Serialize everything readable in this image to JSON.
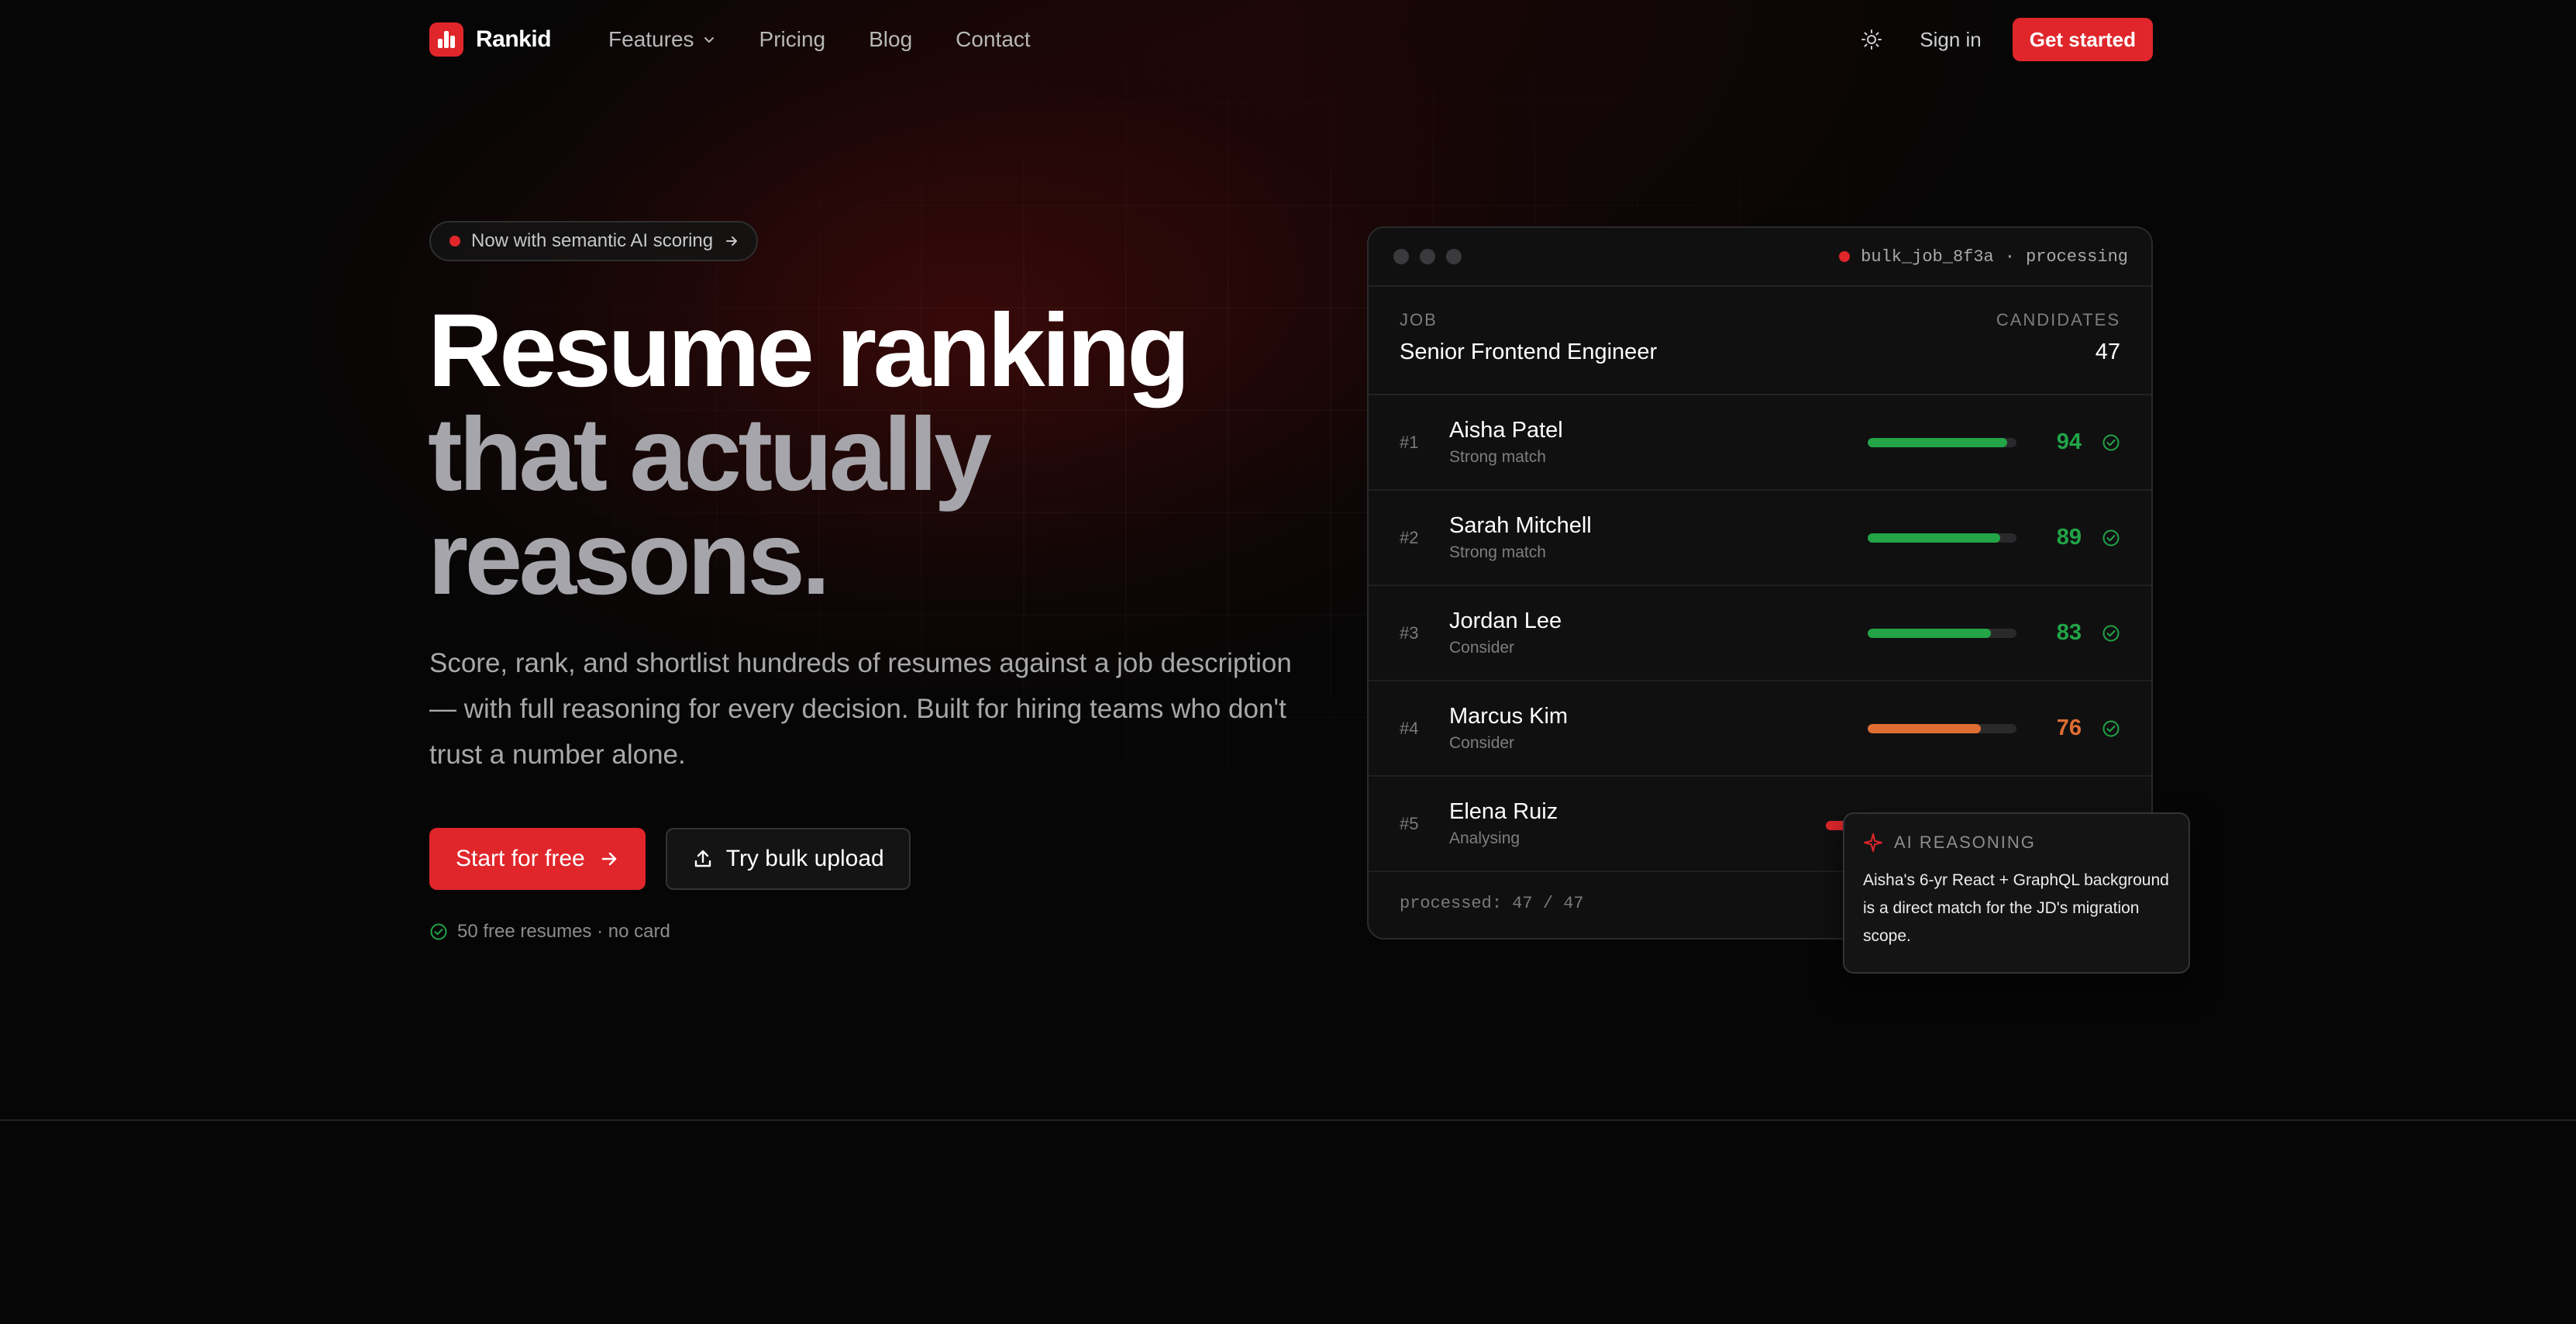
{
  "brand": {
    "name": "Rankid",
    "accent": "#e0262b"
  },
  "nav": {
    "links": [
      {
        "label": "Features",
        "has_dropdown": true
      },
      {
        "label": "Pricing"
      },
      {
        "label": "Blog"
      },
      {
        "label": "Contact"
      }
    ],
    "theme_icon": "sun-icon",
    "sign_in": "Sign in",
    "get_started": "Get started"
  },
  "hero": {
    "badge": "Now with semantic AI scoring",
    "title_line1": "Resume ranking",
    "title_line2": "that actually",
    "title_line3": "reasons.",
    "subtitle": "Score, rank, and shortlist hundreds of resumes against a job description — with full reasoning for every decision. Built for hiring teams who don't trust a number alone.",
    "cta_primary": "Start for free",
    "cta_secondary": "Try bulk upload",
    "note": "50 free resumes · no card"
  },
  "panel": {
    "job_id": "bulk_job_8f3a",
    "status": "processing",
    "job_caption": "JOB",
    "job_title": "Senior Frontend Engineer",
    "candidates_caption": "CANDIDATES",
    "candidates_count": "47",
    "rows": [
      {
        "rank": "#1",
        "name": "Aisha Patel",
        "label": "Strong match",
        "score": 94,
        "score_text": "94",
        "color": "#22a447"
      },
      {
        "rank": "#2",
        "name": "Sarah Mitchell",
        "label": "Strong match",
        "score": 89,
        "score_text": "89",
        "color": "#22a447"
      },
      {
        "rank": "#3",
        "name": "Jordan Lee",
        "label": "Consider",
        "score": 83,
        "score_text": "83",
        "color": "#22a447"
      },
      {
        "rank": "#4",
        "name": "Marcus Kim",
        "label": "Consider",
        "score": 76,
        "score_text": "76",
        "color": "#e06d33"
      },
      {
        "rank": "#5",
        "name": "Elena Ruiz",
        "label": "Analysing",
        "score": null,
        "score_text": "",
        "color": "#e0262b"
      }
    ],
    "footer": "processed: 47 / 47"
  },
  "reasoning": {
    "title": "AI REASONING",
    "text": "Aisha's 6-yr React + GraphQL background is a direct match for the JD's migration scope."
  }
}
